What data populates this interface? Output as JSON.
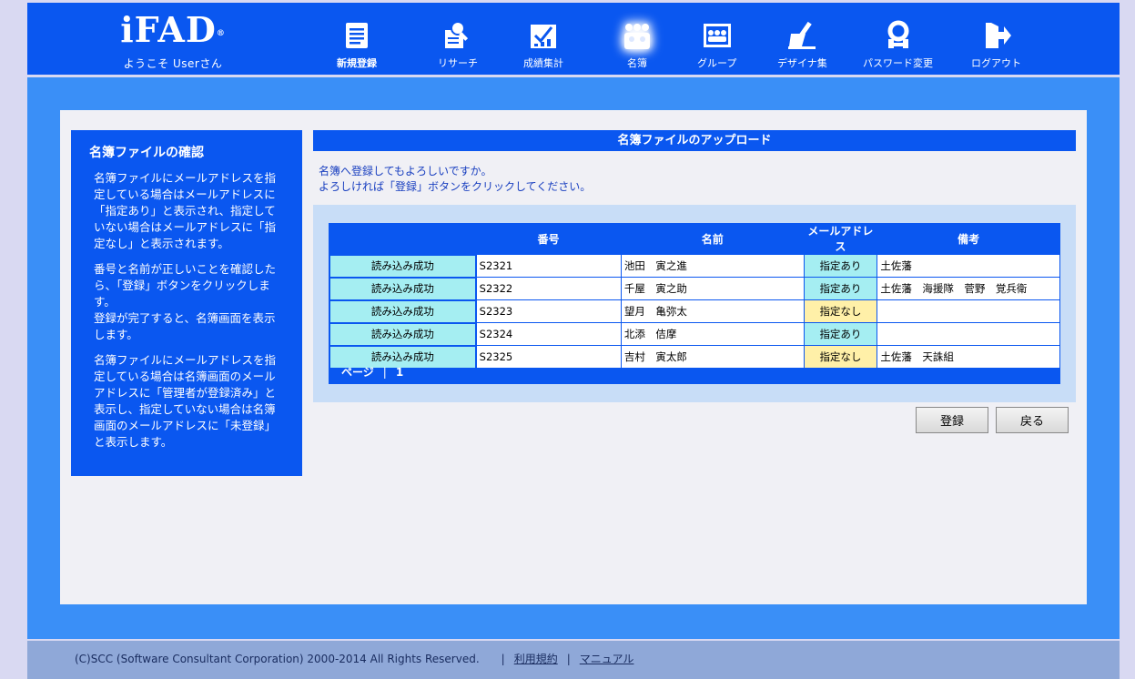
{
  "header": {
    "logo": "iFAD",
    "logo_mark": "®",
    "welcome": "ようこそ Userさん",
    "nav": [
      {
        "label": "新規登録",
        "icon": "document-icon"
      },
      {
        "label": "リサーチ",
        "icon": "research-icon"
      },
      {
        "label": "成績集計",
        "icon": "grades-icon"
      },
      {
        "label": "名簿",
        "icon": "roster-icon"
      },
      {
        "label": "グループ",
        "icon": "group-icon"
      },
      {
        "label": "デザイナ集",
        "icon": "designer-icon"
      },
      {
        "label": "パスワード変更",
        "icon": "password-icon"
      },
      {
        "label": "ログアウト",
        "icon": "logout-icon"
      }
    ]
  },
  "sidebar": {
    "title": "名簿ファイルの確認",
    "p1": "名簿ファイルにメールアドレスを指定している場合はメールアドレスに「指定あり」と表示され、指定していない場合はメールアドレスに「指定なし」と表示されます。",
    "p2": "番号と名前が正しいことを確認したら、「登録」ボタンをクリックします。",
    "p3": "登録が完了すると、名簿画面を表示します。",
    "p4": "名簿ファイルにメールアドレスを指定している場合は名簿画面のメールアドレスに「管理者が登録済み」と表示し、指定していない場合は名簿画面のメールアドレスに「未登録」と表示します。"
  },
  "main": {
    "title": "名簿ファイルのアップロード",
    "message1": "名簿へ登録してもよろしいですか。",
    "message2": "よろしければ「登録」ボタンをクリックしてください。",
    "columns": [
      "",
      "番号",
      "名前",
      "メールアドレス",
      "備考"
    ],
    "rows": [
      {
        "status": "読み込み成功",
        "number": "S2321",
        "name": "池田　寅之進",
        "mail": "指定あり",
        "note": "土佐藩"
      },
      {
        "status": "読み込み成功",
        "number": "S2322",
        "name": "千屋　寅之助",
        "mail": "指定あり",
        "note": "土佐藩　海援隊　菅野　覚兵衛"
      },
      {
        "status": "読み込み成功",
        "number": "S2323",
        "name": "望月　亀弥太",
        "mail": "指定なし",
        "note": ""
      },
      {
        "status": "読み込み成功",
        "number": "S2324",
        "name": "北添　佶摩",
        "mail": "指定あり",
        "note": ""
      },
      {
        "status": "読み込み成功",
        "number": "S2325",
        "name": "吉村　寅太郎",
        "mail": "指定なし",
        "note": "土佐藩　天誅組"
      }
    ],
    "pager_label": "ページ",
    "pager_sep": "|",
    "pager_page": "1",
    "register_label": "登録",
    "back_label": "戻る"
  },
  "footer": {
    "copyright": "(C)SCC (Software Consultant Corporation) 2000-2014 All Rights Reserved.",
    "sep": "|",
    "terms": "利用規約",
    "manual": "マニュアル"
  }
}
